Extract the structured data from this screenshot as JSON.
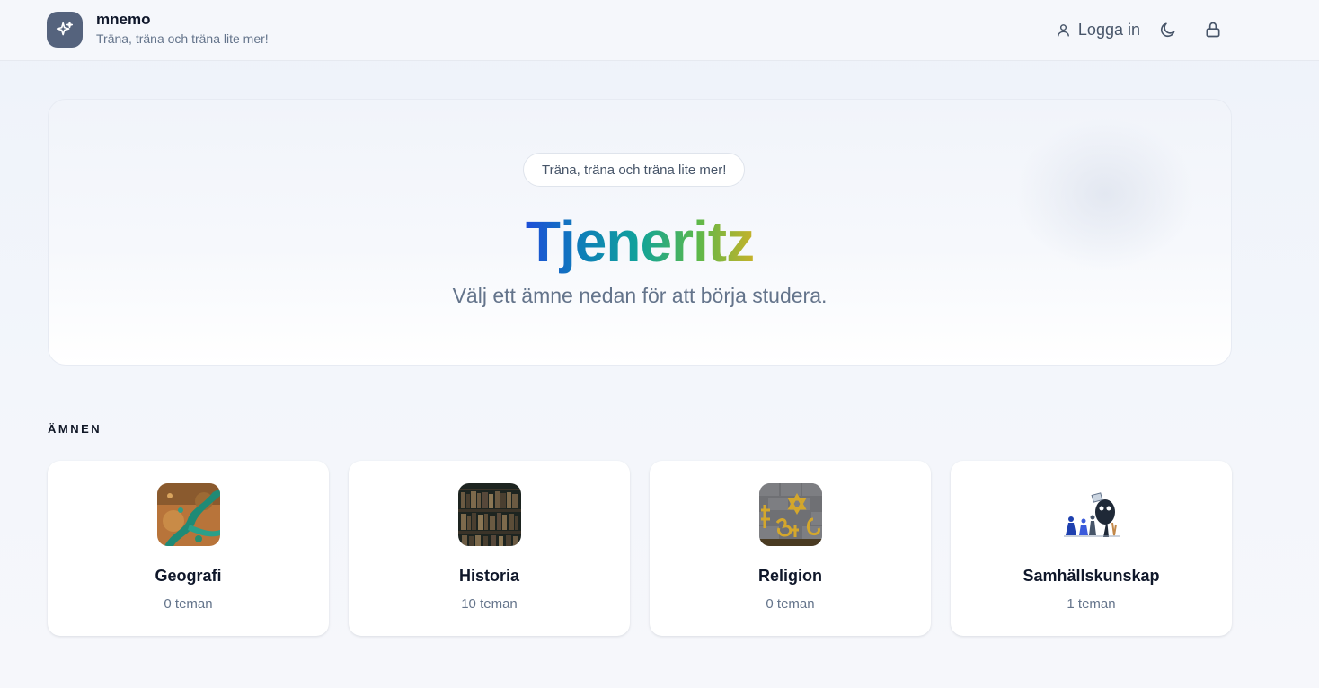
{
  "header": {
    "brand_name": "mnemo",
    "brand_tagline": "Träna, träna och träna lite mer!",
    "login_label": "Logga in",
    "icons": [
      "sparkles-icon",
      "user-icon",
      "moon-icon",
      "lock-icon"
    ]
  },
  "hero": {
    "pill_text": "Träna, träna och träna lite mer!",
    "title": "Tjeneritz",
    "subtitle": "Välj ett ämne nedan för att börja studera.",
    "title_gradient": [
      "#1d4ed8",
      "#11a39a",
      "#c6b22a"
    ]
  },
  "subjects_heading": "ÄMNEN",
  "subjects": [
    {
      "name": "Geografi",
      "count": "0 teman",
      "image": "satellite-river-map"
    },
    {
      "name": "Historia",
      "count": "10 teman",
      "image": "old-library-books"
    },
    {
      "name": "Religion",
      "count": "0 teman",
      "image": "religious-symbols"
    },
    {
      "name": "Samhällskunskap",
      "count": "1 teman",
      "image": "people-illustration"
    }
  ],
  "colors": {
    "accent_logo": "#55637d",
    "text_primary": "#0f172a",
    "text_muted": "#64748b",
    "background": "#f4f6fb"
  }
}
